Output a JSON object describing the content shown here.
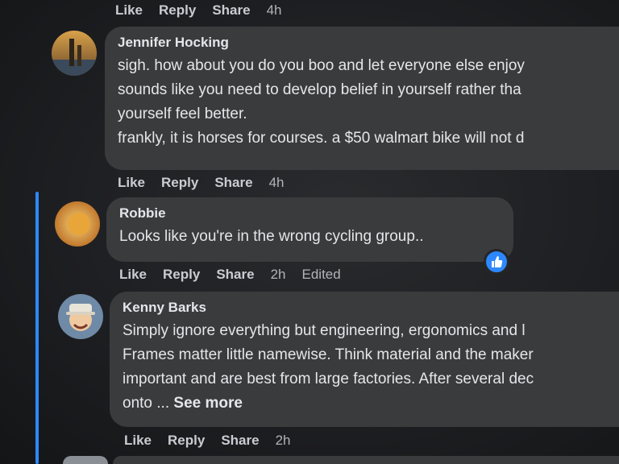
{
  "top_actions": {
    "like": "Like",
    "reply": "Reply",
    "share": "Share",
    "time": "4h"
  },
  "comments": [
    {
      "author": "Jennifer Hocking",
      "lines": [
        "sigh. how about you do you boo and let everyone else enjoy",
        "sounds like you need to develop belief in yourself rather tha",
        "yourself feel better.",
        "frankly, it is horses for courses. a $50 walmart bike will not d"
      ],
      "actions": {
        "like": "Like",
        "reply": "Reply",
        "share": "Share",
        "time": "4h"
      }
    },
    {
      "author": "Robbie",
      "lines": [
        "Looks like you're in the wrong cycling group.."
      ],
      "actions": {
        "like": "Like",
        "reply": "Reply",
        "share": "Share",
        "time": "2h",
        "edited": "Edited"
      }
    },
    {
      "author": "Kenny Barks",
      "lines": [
        "Simply ignore everything but engineering, ergonomics and l",
        "Frames matter little namewise. Think material and the maker",
        "important and are best from large factories. After several dec",
        "onto ..."
      ],
      "see_more": "See more",
      "actions": {
        "like": "Like",
        "reply": "Reply",
        "share": "Share",
        "time": "2h"
      }
    }
  ],
  "colors": {
    "bubble": "#3a3b3c",
    "accent": "#2d88ff",
    "background": "#1e1f22"
  }
}
